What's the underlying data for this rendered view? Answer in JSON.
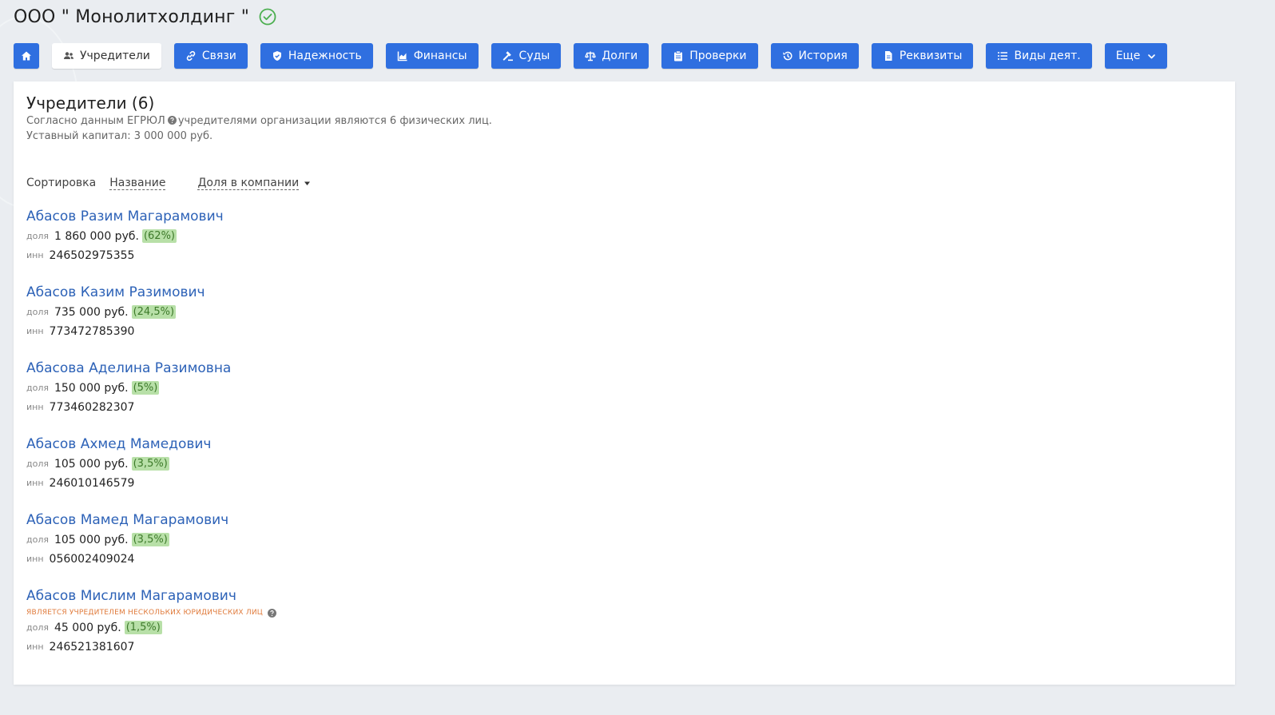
{
  "company": {
    "title": "ООО \" Монолитхолдинг \""
  },
  "nav": {
    "items": [
      {
        "label": "Учредители"
      },
      {
        "label": "Связи"
      },
      {
        "label": "Надежность"
      },
      {
        "label": "Финансы"
      },
      {
        "label": "Суды"
      },
      {
        "label": "Долги"
      },
      {
        "label": "Проверки"
      },
      {
        "label": "История"
      },
      {
        "label": "Реквизиты"
      },
      {
        "label": "Виды деят."
      },
      {
        "label": "Еще"
      }
    ]
  },
  "section": {
    "title": "Учредители (6)",
    "desc_prefix": "Согласно данным ЕГРЮЛ",
    "desc_suffix": "учредителями организации являются 6 физических лиц.",
    "capital": "Уставный капитал: 3 000 000 руб."
  },
  "sort": {
    "label": "Сортировка",
    "by_name": "Название",
    "by_share": "Доля в компании"
  },
  "labels": {
    "share": "доля",
    "inn": "инн"
  },
  "founders": [
    {
      "name": "Абасов Разим Магарамович",
      "share": "1 860 000 руб.",
      "percent": "(62%)",
      "inn": "246502975355"
    },
    {
      "name": "Абасов Казим Разимович",
      "share": "735 000 руб.",
      "percent": "(24,5%)",
      "inn": "773472785390"
    },
    {
      "name": "Абасова Аделина Разимовна",
      "share": "150 000 руб.",
      "percent": "(5%)",
      "inn": "773460282307"
    },
    {
      "name": "Абасов Ахмед Мамедович",
      "share": "105 000 руб.",
      "percent": "(3,5%)",
      "inn": "246010146579"
    },
    {
      "name": "Абасов Мамед Магарамович",
      "share": "105 000 руб.",
      "percent": "(3,5%)",
      "inn": "056002409024"
    },
    {
      "name": "Абасов Мислим Магарамович",
      "note": "является учредителем нескольких юридических лиц",
      "share": "45 000 руб.",
      "percent": "(1,5%)",
      "inn": "246521381607"
    }
  ],
  "colors": {
    "accent": "#2f6fe0",
    "link": "#2d62b7",
    "percent_bg": "#b8e0a8",
    "note": "#e07b3c",
    "verified": "#4caf50"
  }
}
